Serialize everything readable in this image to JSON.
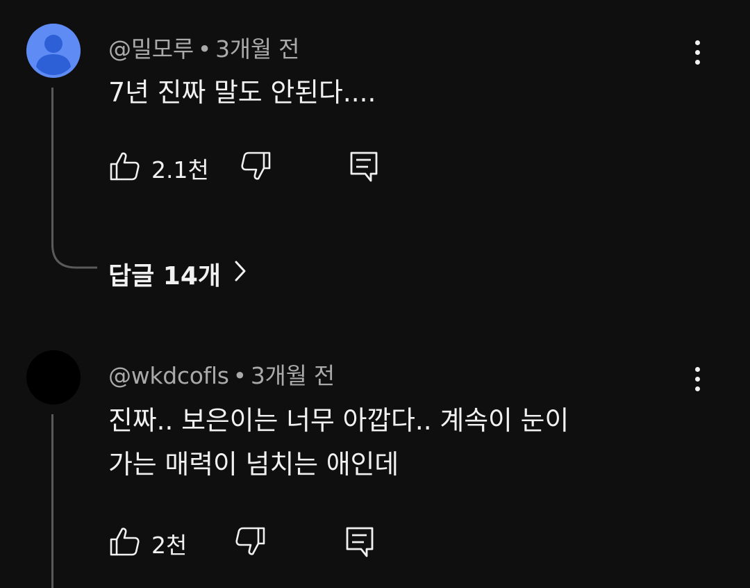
{
  "comments": [
    {
      "author": "@밀모루",
      "separator": "•",
      "time": "3개월 전",
      "text": "7년 진짜 말도 안된다....",
      "likes": "2.1천",
      "avatar_type": "default-person-icon",
      "avatar_color": "#5f8bf4",
      "replies_label": "답글 14개"
    },
    {
      "author": "@wkdcofls",
      "separator": "•",
      "time": "3개월 전",
      "text": "진짜.. 보은이는 너무 아깝다.. 계속이 눈이\n가는 매력이 넘치는 애인데",
      "likes": "2천",
      "avatar_type": "black-avatar",
      "avatar_color": "#000000"
    }
  ],
  "icons": {
    "like": "thumbs-up-icon",
    "dislike": "thumbs-down-icon",
    "reply": "reply-icon",
    "more": "more-vertical-icon",
    "chevron": "chevron-right-icon"
  },
  "colors": {
    "background": "#0f0f0f",
    "primary_text": "#f1f1f1",
    "secondary_text": "#aaaaaa",
    "thread_line": "#5a5a5a"
  }
}
